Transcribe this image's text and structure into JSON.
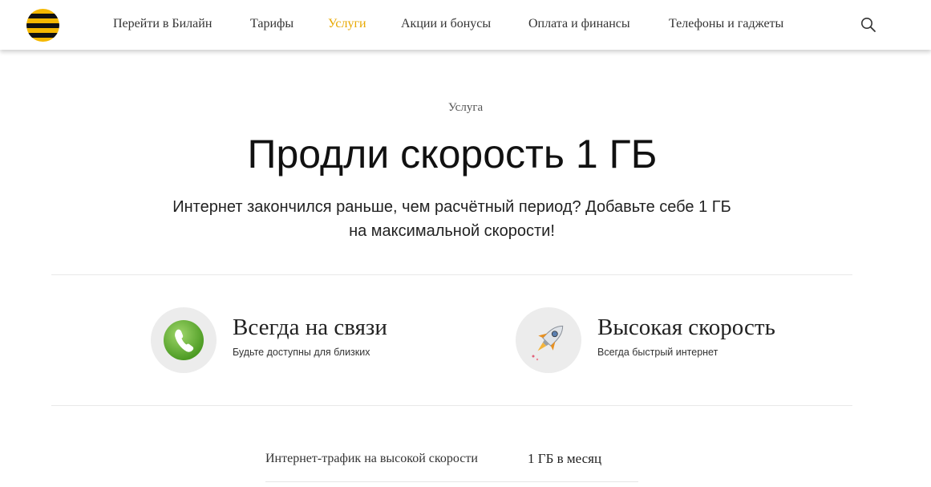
{
  "header": {
    "nav": [
      {
        "label": "Перейти в Билайн",
        "active": false
      },
      {
        "label": "Тарифы",
        "active": false
      },
      {
        "label": "Услуги",
        "active": true
      },
      {
        "label": "Акции и бонусы",
        "active": false
      },
      {
        "label": "Оплата и финансы",
        "active": false
      },
      {
        "label": "Телефоны и гаджеты",
        "active": false
      }
    ],
    "search_icon": "search-icon"
  },
  "hero": {
    "kicker": "Услуга",
    "title": "Продли скорость 1 ГБ",
    "subtitle": "Интернет закончился раньше, чем расчётный период? Добавьте себе 1 ГБ на максимальной скорости!"
  },
  "features": [
    {
      "icon": "phone-icon",
      "title": "Всегда на связи",
      "description": "Будьте доступны для близких"
    },
    {
      "icon": "rocket-icon",
      "title": "Высокая скорость",
      "description": "Всегда быстрый интернет"
    }
  ],
  "specs": [
    {
      "label": "Интернет-трафик на высокой скорости",
      "value": "1 ГБ в месяц"
    }
  ],
  "colors": {
    "accent": "#e8a800",
    "brand_yellow": "#f5b800",
    "brand_black": "#111111"
  }
}
